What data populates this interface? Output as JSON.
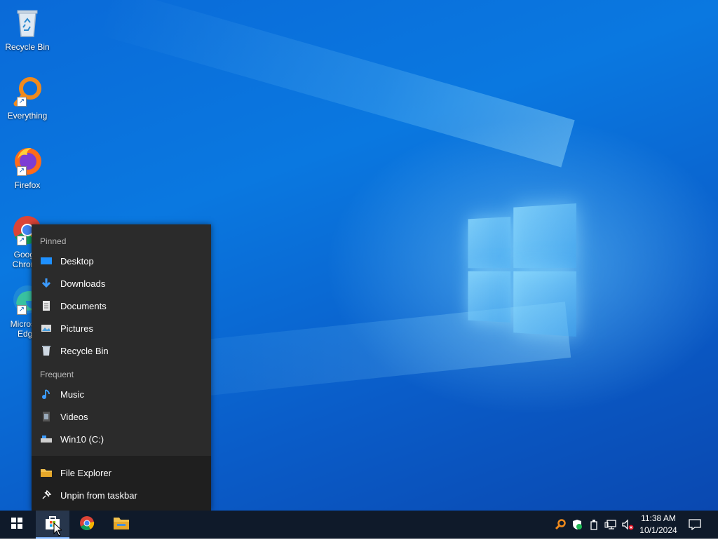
{
  "desktop": {
    "icons": [
      {
        "label": "Recycle Bin",
        "icon": "recycle-bin-icon"
      },
      {
        "label": "Everything",
        "icon": "everything-search-icon"
      },
      {
        "label": "Firefox",
        "icon": "firefox-icon"
      },
      {
        "label": "Google Chrome",
        "icon": "chrome-icon"
      },
      {
        "label": "Microsoft Edge",
        "icon": "edge-icon"
      }
    ]
  },
  "jumplist": {
    "pinned_header": "Pinned",
    "pinned": [
      {
        "label": "Desktop",
        "icon": "desktop-folder-icon"
      },
      {
        "label": "Downloads",
        "icon": "downloads-arrow-icon"
      },
      {
        "label": "Documents",
        "icon": "document-icon"
      },
      {
        "label": "Pictures",
        "icon": "pictures-icon"
      },
      {
        "label": "Recycle Bin",
        "icon": "recycle-bin-icon"
      }
    ],
    "frequent_header": "Frequent",
    "frequent": [
      {
        "label": "Music",
        "icon": "music-note-icon"
      },
      {
        "label": "Videos",
        "icon": "videos-icon"
      },
      {
        "label": "Win10 (C:)",
        "icon": "drive-icon"
      }
    ],
    "actions": [
      {
        "label": "File Explorer",
        "icon": "file-explorer-icon"
      },
      {
        "label": "Unpin from taskbar",
        "icon": "unpin-icon"
      }
    ]
  },
  "taskbar": {
    "time": "11:38 AM",
    "date": "10/1/2024"
  },
  "colors": {
    "taskbar": "#0f1a2a",
    "jumplist": "#2b2b2b",
    "accent": "#0078d7"
  }
}
